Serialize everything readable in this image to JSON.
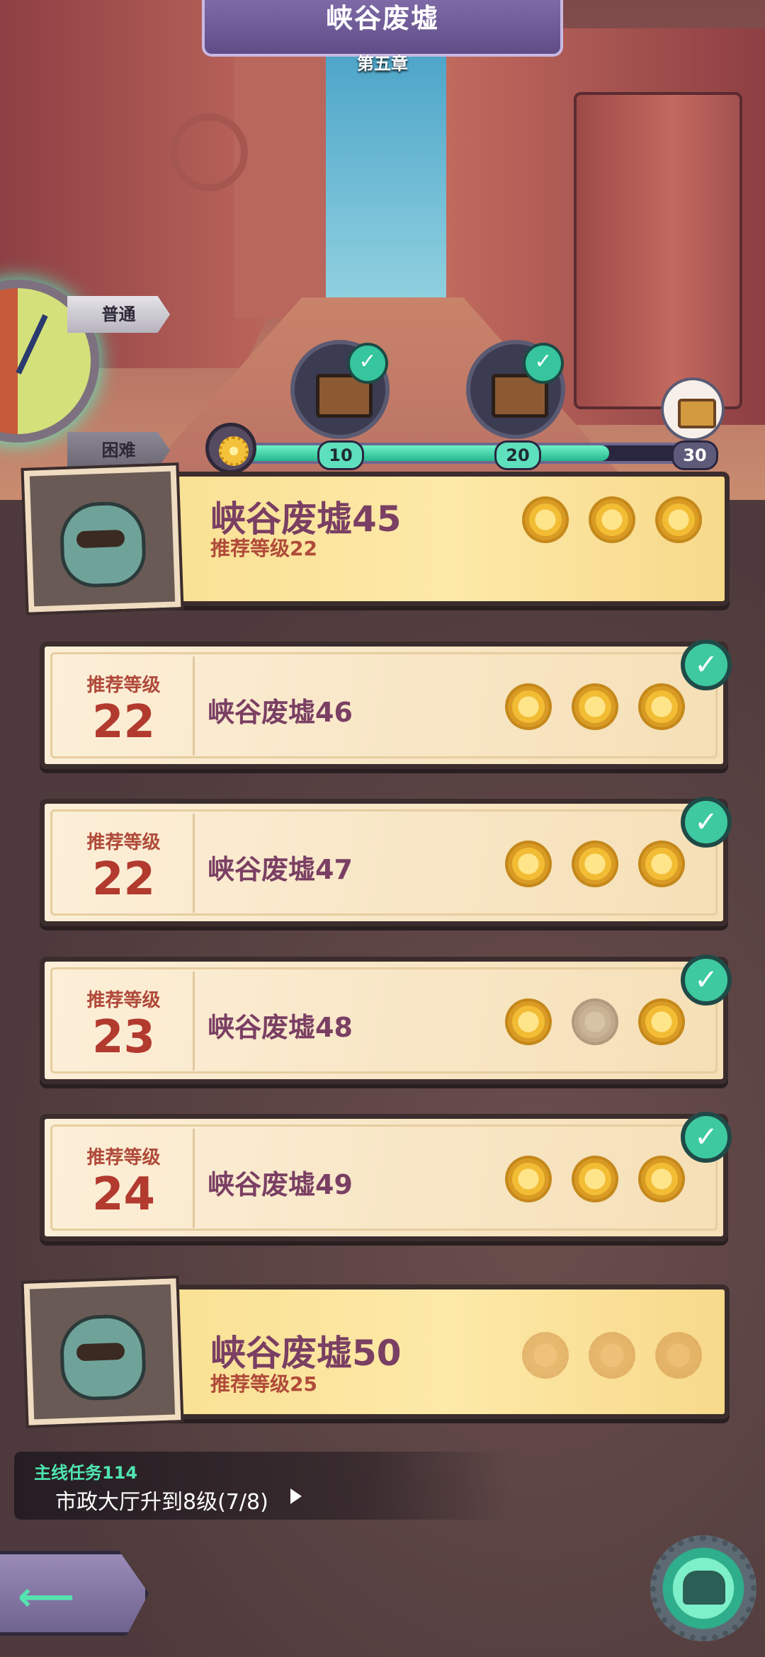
{
  "header": {
    "title": "峡谷废墟",
    "chapter": "第五章"
  },
  "modes": {
    "normal": "普通",
    "hard": "困难"
  },
  "progress": {
    "fraction": 0.8,
    "milestones": [
      "10",
      "20",
      "30"
    ]
  },
  "stages": [
    {
      "name": "峡谷废墟45",
      "level_label": "推荐等级22",
      "stars": 3,
      "cleared": true,
      "featured": true
    },
    {
      "name": "峡谷废墟46",
      "level_label": "推荐等级",
      "level": "22",
      "stars": 3,
      "cleared": true
    },
    {
      "name": "峡谷废墟47",
      "level_label": "推荐等级",
      "level": "22",
      "stars": 3,
      "cleared": true
    },
    {
      "name": "峡谷废墟48",
      "level_label": "推荐等级",
      "level": "23",
      "stars": 2,
      "cleared": true
    },
    {
      "name": "峡谷废墟49",
      "level_label": "推荐等级",
      "level": "24",
      "stars": 3,
      "cleared": true
    },
    {
      "name": "峡谷废墟50",
      "level_label": "推荐等级25",
      "stars": 0,
      "cleared": false,
      "featured": true
    }
  ],
  "quest": {
    "title": "主线任务114",
    "desc": "市政大厅升到8级(7/8)"
  },
  "colors": {
    "accent": "#3ec9a0",
    "stage_name": "#7a3f63",
    "level": "#b23a2e"
  },
  "icons": {
    "back": "arrow-left-icon",
    "shop": "shop-icon",
    "check": "check-icon"
  }
}
